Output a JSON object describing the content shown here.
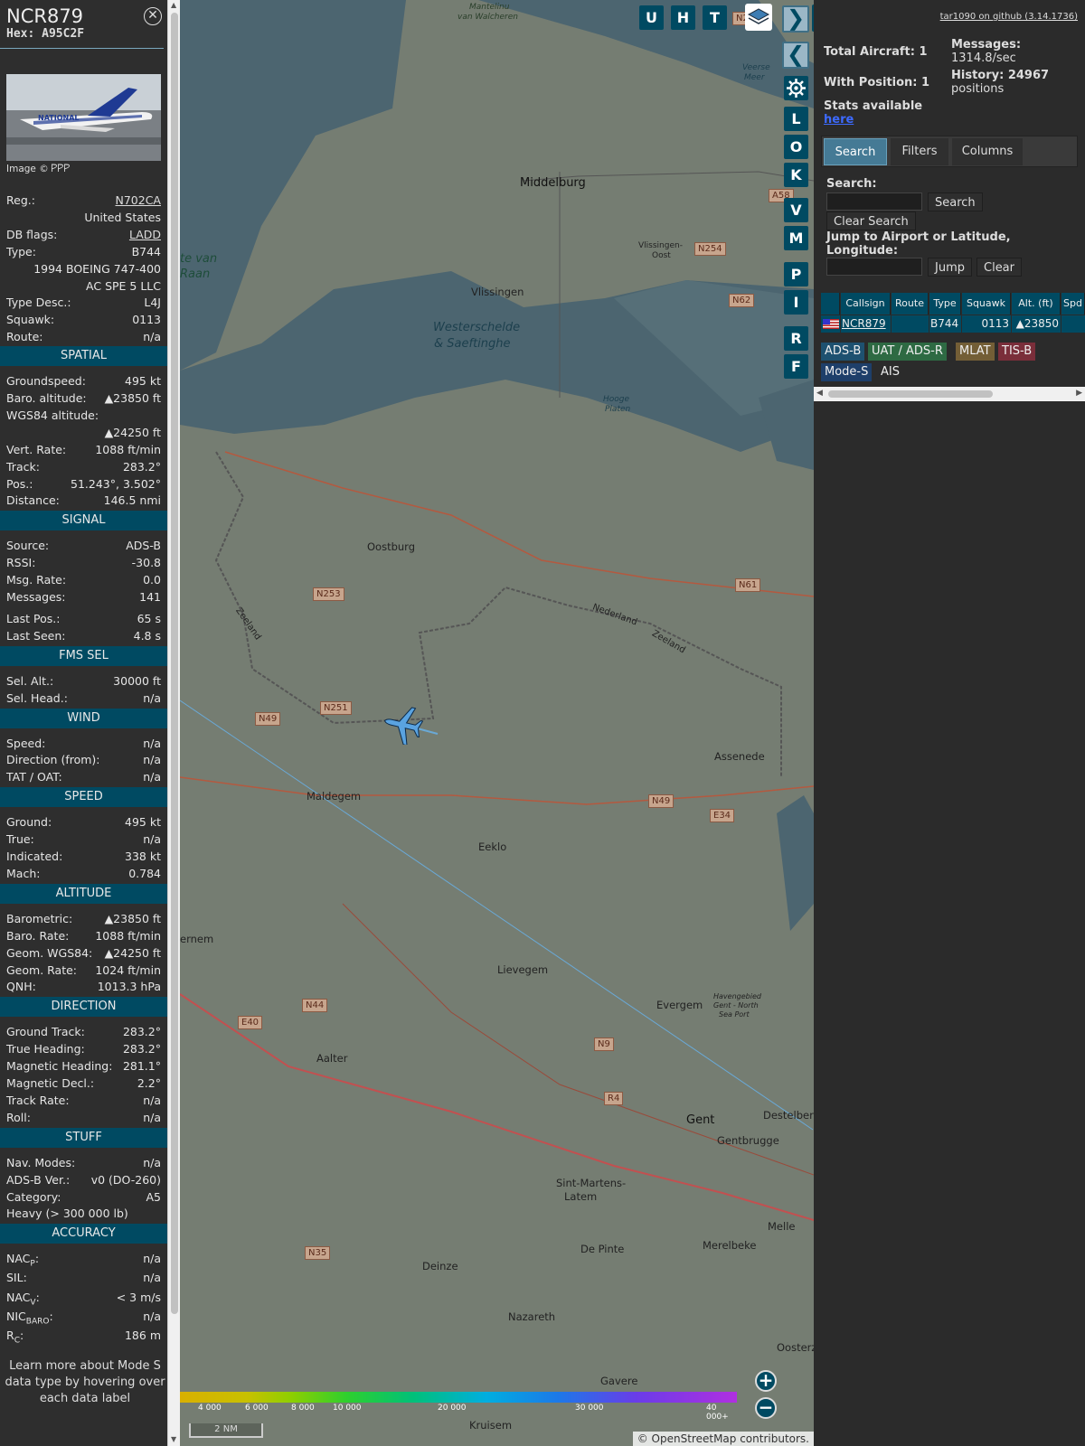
{
  "selected": {
    "callsign": "NCR879",
    "hex_label": "Hex: A95C2F",
    "photo_credit": "Image © 𐊕𐊕𐊕",
    "photo_livery_text": "NATIONAL",
    "basic": [
      {
        "label": "Reg.:",
        "value": "N702CA",
        "link": true
      },
      {
        "label": "",
        "value": "United States"
      },
      {
        "label": "DB flags:",
        "value": "LADD",
        "link": true
      },
      {
        "label": "Type:",
        "value": "B744"
      },
      {
        "label": "",
        "value": "1994 BOEING 747-400"
      },
      {
        "label": "",
        "value": "AC SPE 5 LLC"
      },
      {
        "label": "Type Desc.:",
        "value": "L4J"
      },
      {
        "label": "Squawk:",
        "value": "0113"
      },
      {
        "label": "Route:",
        "value": "n/a"
      }
    ],
    "sections": [
      {
        "title": "SPATIAL",
        "rows": [
          {
            "label": "Groundspeed:",
            "value": "495 kt"
          },
          {
            "label": "Baro. altitude:",
            "value": "▲23850 ft"
          },
          {
            "label": "WGS84 altitude:",
            "value": ""
          },
          {
            "label": "",
            "value": "▲24250 ft"
          },
          {
            "label": "Vert. Rate:",
            "value": "1088 ft/min"
          },
          {
            "label": "Track:",
            "value": "283.2°"
          },
          {
            "label": "Pos.:",
            "value": "51.243°, 3.502°"
          },
          {
            "label": "Distance:",
            "value": "146.5 nmi"
          }
        ]
      },
      {
        "title": "SIGNAL",
        "rows": [
          {
            "label": "Source:",
            "value": "ADS-B"
          },
          {
            "label": "RSSI:",
            "value": "-30.8"
          },
          {
            "label": "Msg. Rate:",
            "value": "0.0"
          },
          {
            "label": "Messages:",
            "value": "141"
          },
          {
            "label": "Last Pos.:",
            "value": "65 s"
          },
          {
            "label": "Last Seen:",
            "value": "4.8 s"
          }
        ]
      },
      {
        "title": "FMS SEL",
        "rows": [
          {
            "label": "Sel. Alt.:",
            "value": "30000 ft"
          },
          {
            "label": "Sel. Head.:",
            "value": "n/a"
          }
        ]
      },
      {
        "title": "WIND",
        "rows": [
          {
            "label": "Speed:",
            "value": "n/a"
          },
          {
            "label": "Direction (from):",
            "value": "n/a"
          },
          {
            "label": "TAT / OAT:",
            "value": "n/a"
          }
        ]
      },
      {
        "title": "SPEED",
        "rows": [
          {
            "label": "Ground:",
            "value": "495 kt"
          },
          {
            "label": "True:",
            "value": "n/a"
          },
          {
            "label": "Indicated:",
            "value": "338 kt"
          },
          {
            "label": "Mach:",
            "value": "0.784"
          }
        ]
      },
      {
        "title": "ALTITUDE",
        "rows": [
          {
            "label": "Barometric:",
            "value": "▲23850 ft"
          },
          {
            "label": "Baro. Rate:",
            "value": "1088 ft/min"
          },
          {
            "label": "Geom. WGS84:",
            "value": "▲24250 ft"
          },
          {
            "label": "Geom. Rate:",
            "value": "1024 ft/min"
          },
          {
            "label": "QNH:",
            "value": "1013.3 hPa"
          }
        ]
      },
      {
        "title": "DIRECTION",
        "rows": [
          {
            "label": "Ground Track:",
            "value": "283.2°"
          },
          {
            "label": "True Heading:",
            "value": "283.2°"
          },
          {
            "label": "Magnetic Heading:",
            "value": "281.1°"
          },
          {
            "label": "Magnetic Decl.:",
            "value": "2.2°"
          },
          {
            "label": "Track Rate:",
            "value": "n/a"
          },
          {
            "label": "Roll:",
            "value": "n/a"
          }
        ]
      },
      {
        "title": "STUFF",
        "rows": [
          {
            "label": "Nav. Modes:",
            "value": "n/a"
          },
          {
            "label": "ADS-B Ver.:",
            "value": "v0 (DO-260)"
          },
          {
            "label": "Category:",
            "value": "A5"
          },
          {
            "label": "Heavy (> 300 000 lb)",
            "value": ""
          }
        ]
      },
      {
        "title": "ACCURACY",
        "rows": [
          {
            "label": "NAC",
            "sub": "P",
            "value": "n/a"
          },
          {
            "label": "SIL:",
            "value": "n/a"
          },
          {
            "label": "NAC",
            "sub": "V",
            "value": "< 3 m/s"
          },
          {
            "label": "NIC",
            "sub": "BARO",
            "value": "n/a"
          },
          {
            "label": "R",
            "sub": "C",
            "value": "186 m"
          }
        ]
      }
    ],
    "footer_text": "Learn more about Mode S data type by hovering over each data label"
  },
  "map": {
    "toolbar": [
      "U",
      "H",
      "T"
    ],
    "side_buttons": [
      "L",
      "O",
      "K",
      "V",
      "M",
      "P",
      "I",
      "R",
      "F"
    ],
    "labels": [
      {
        "text": "Middelburg"
      },
      {
        "text": "Vlissingen"
      },
      {
        "text": "Westerschelde"
      },
      {
        "text": "& Saeftinghe"
      },
      {
        "text": "Oostburg"
      },
      {
        "text": "Maldegem"
      },
      {
        "text": "Eeklo"
      },
      {
        "text": "Assenede"
      },
      {
        "text": "Lievegem"
      },
      {
        "text": "Evergem"
      },
      {
        "text": "Aalter"
      },
      {
        "text": "Gent"
      },
      {
        "text": "Gentbrugge"
      },
      {
        "text": "Sint-Martens-"
      },
      {
        "text": "Latem"
      },
      {
        "text": "Deinze"
      },
      {
        "text": "De Pinte"
      },
      {
        "text": "Merelbeke"
      },
      {
        "text": "Nazareth"
      },
      {
        "text": "Gavere"
      },
      {
        "text": "Kruisem"
      },
      {
        "text": "Destelberg"
      },
      {
        "text": "Melle"
      },
      {
        "text": "ernem"
      },
      {
        "text": "Mantelinu"
      },
      {
        "text": "van Walcheren"
      },
      {
        "text": "Veerse"
      },
      {
        "text": "Meer"
      },
      {
        "text": "Vlissingen-"
      },
      {
        "text": "Oost"
      },
      {
        "text": "Hooge"
      },
      {
        "text": "Platen"
      },
      {
        "text": "Nederland"
      },
      {
        "text": "Zeeland"
      },
      {
        "text": "Zeeland"
      },
      {
        "text": "Havengebied"
      },
      {
        "text": "Gent - North"
      },
      {
        "text": "Sea Port"
      },
      {
        "text": "te van"
      },
      {
        "text": "Raan"
      },
      {
        "text": "Oosterz"
      }
    ],
    "roads": [
      "N253",
      "N61",
      "N251",
      "N49",
      "N49",
      "E34",
      "N44",
      "E40",
      "N9",
      "R4",
      "N35",
      "N254",
      "N62",
      "A58",
      "N2"
    ],
    "legend_ticks": [
      "4 000",
      "6 000",
      "8 000",
      "10 000",
      "20 000",
      "30 000",
      "40 000+"
    ],
    "scale_label": "2 NM",
    "attribution": "© OpenStreetMap contributors."
  },
  "side": {
    "version_link": "tar1090 on github (3.14.1736)",
    "total_aircraft": "Total Aircraft: 1",
    "with_position": "With Position: 1",
    "stats_label": "Stats available",
    "stats_link": "here",
    "messages_label": "Messages:",
    "messages_value": "1314.8/sec",
    "history_label": "History: 24967",
    "history_value": "positions",
    "tabs": [
      "Search",
      "Filters",
      "Columns"
    ],
    "search_label": "Search:",
    "search_button": "Search",
    "clear_search": "Clear Search",
    "jump_label": "Jump to Airport or Latitude, Longitude:",
    "jump_button": "Jump",
    "clear_button": "Clear",
    "table_headers": [
      "",
      "Callsign",
      "Route",
      "Type",
      "Squawk",
      "Alt. (ft)",
      "Spd"
    ],
    "table_row": {
      "callsign": "NCR879",
      "route": "",
      "type": "B744",
      "squawk": "0113",
      "alt": "▲23850"
    },
    "sources": [
      "ADS-B",
      "UAT / ADS-R",
      "MLAT",
      "TIS-B",
      "Mode-S",
      "AIS"
    ],
    "colors": {
      "adsb": "#1e5170",
      "uat": "#2e6a43",
      "mlat": "#735e36",
      "tisb": "#7a2e3a",
      "modes": "#1e3f6a"
    }
  }
}
